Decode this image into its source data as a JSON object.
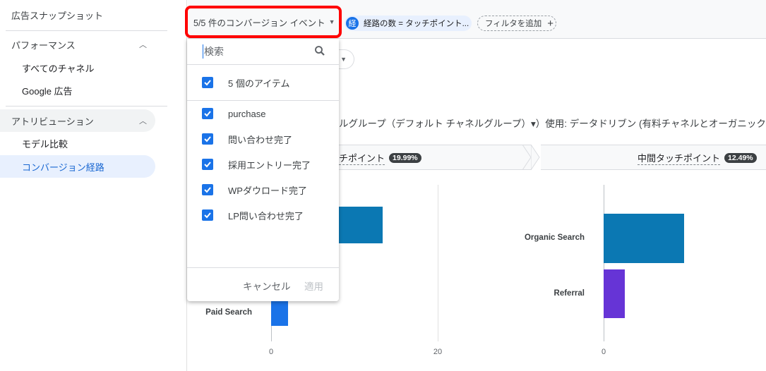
{
  "sidebar": {
    "top_item": "広告スナップショット",
    "sections": [
      {
        "label": "パフォーマンス",
        "items": [
          "すべてのチャネル",
          "Google 広告"
        ]
      },
      {
        "label": "アトリビューション",
        "items": [
          "モデル比較",
          "コンバージョン経路"
        ]
      }
    ],
    "active": "コンバージョン経路"
  },
  "toolbar": {
    "conversion_events": "5/5 件のコンバージョン イベント",
    "filter_chip_badge": "経",
    "filter_chip": "経路の数 = タッチポイント...",
    "add_filter": "フィルタを追加"
  },
  "description": "ルグループ（デフォルト チャネルグループ）▾）使用: データドリブン (有料チャネルとオーガニック チ",
  "touchpoints": [
    {
      "label": "チポイント",
      "pct": "19.99%"
    },
    {
      "label": "中間タッチポイント",
      "pct": "12.49%"
    }
  ],
  "dropdown": {
    "search_placeholder": "検索",
    "select_all": "5 個のアイテム",
    "items": [
      "purchase",
      "問い合わせ完了",
      "採用エントリー完了",
      "WPダウロード完了",
      "LP問い合わせ完了"
    ],
    "cancel": "キャンセル",
    "apply": "適用"
  },
  "colors": {
    "accent": "#1a73e8",
    "highlight": "#ff0000"
  },
  "chart_data": [
    {
      "type": "bar",
      "orientation": "horizontal",
      "categories": [
        "",
        "Paid Search"
      ],
      "values": [
        13.4,
        2
      ],
      "colors": [
        "#0b78b3",
        "#1a73e8"
      ],
      "xticks": [
        "0",
        "20"
      ],
      "xlim": [
        0,
        20
      ]
    },
    {
      "type": "bar",
      "orientation": "horizontal",
      "categories": [
        "Organic Search",
        "Referral"
      ],
      "values": [
        9.7,
        2.5
      ],
      "colors": [
        "#0b78b3",
        "#6634d6"
      ],
      "xticks": [
        "0"
      ]
    }
  ]
}
